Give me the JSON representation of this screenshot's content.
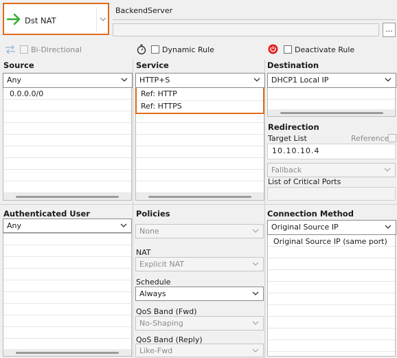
{
  "action": {
    "label": "Dst NAT",
    "color": "#2fae2f",
    "icon": "green-arrow-icon"
  },
  "rule_name": "BackendServer",
  "more_button": "...",
  "options": {
    "bidirectional": "Bi-Directional",
    "dynamic_rule": "Dynamic Rule",
    "deactivate_rule": "Deactivate Rule"
  },
  "source": {
    "heading": "Source",
    "selected": "Any",
    "items": [
      "0.0.0.0/0"
    ]
  },
  "service": {
    "heading": "Service",
    "selected": "HTTP+S",
    "items": [
      "Ref: HTTP",
      "Ref: HTTPS"
    ]
  },
  "destination": {
    "heading": "Destination",
    "selected": "DHCP1 Local IP"
  },
  "redirection": {
    "heading": "Redirection",
    "target_list_label": "Target List",
    "reference_label": "Reference",
    "target_value": "10.10.10.4",
    "fallback": "Fallback",
    "critical_ports_label": "List of Critical Ports"
  },
  "authenticated_user": {
    "heading": "Authenticated User",
    "selected": "Any"
  },
  "policies": {
    "heading": "Policies",
    "policy_value": "None",
    "nat_label": "NAT",
    "nat_value": "Explicit NAT",
    "schedule_label": "Schedule",
    "schedule_value": "Always",
    "qos_fwd_label": "QoS Band (Fwd)",
    "qos_fwd_value": "No-Shaping",
    "qos_reply_label": "QoS Band (Reply)",
    "qos_reply_value": "Like-Fwd"
  },
  "connection_method": {
    "heading": "Connection Method",
    "selected": "Original Source IP",
    "items": [
      "Original Source IP (same port)"
    ]
  },
  "colors": {
    "accent_highlight": "#e06a18",
    "deactivate_red": "#e02020"
  }
}
